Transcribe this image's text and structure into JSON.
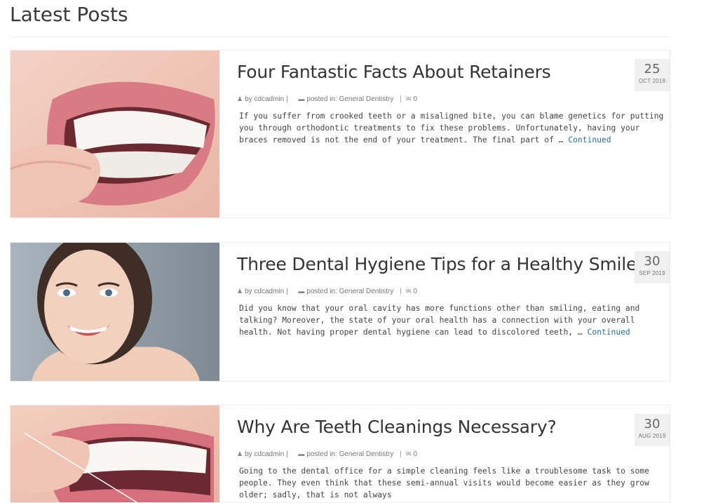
{
  "section": {
    "heading": "Latest Posts"
  },
  "meta_labels": {
    "by": "by",
    "posted_in": "posted in:",
    "separator": "|"
  },
  "posts": [
    {
      "title": "Four Fantastic Facts About Retainers",
      "author": "cdcadmin",
      "category": "General Dentistry",
      "comments": "0",
      "excerpt": "If you suffer from crooked teeth or a misaligned bite, you can blame genetics for putting you through orthodontic treatments to fix these problems. Unfortunately, having your braces removed is not the end of your treatment. The final part of …",
      "more": "Continued",
      "day": "25",
      "month_year": "OCT 2019"
    },
    {
      "title": "Three Dental Hygiene Tips for a Healthy Smile",
      "author": "cdcadmin",
      "category": "General Dentistry",
      "comments": "0",
      "excerpt": "Did you know that your oral cavity has more functions other than smiling, eating and talking? Moreover, the state of your oral health has a connection with your overall health. Not having proper dental hygiene can lead to discolored teeth, …",
      "more": "Continued",
      "day": "30",
      "month_year": "SEP 2019"
    },
    {
      "title": "Why Are Teeth Cleanings Necessary?",
      "author": "cdcadmin",
      "category": "General Dentistry",
      "comments": "0",
      "excerpt": "Going to the dental office for a simple cleaning feels like a troublesome task to some people. They even think that these semi-annual visits would become easier as they grow older; sadly, that is not always",
      "more": "",
      "day": "30",
      "month_year": "AUG 2019"
    }
  ],
  "icons": {
    "user": "user-icon",
    "folder": "folder-icon",
    "comment": "comment-icon"
  },
  "colors": {
    "link": "#2a6f9a",
    "date_bg": "#f0f0f0"
  }
}
